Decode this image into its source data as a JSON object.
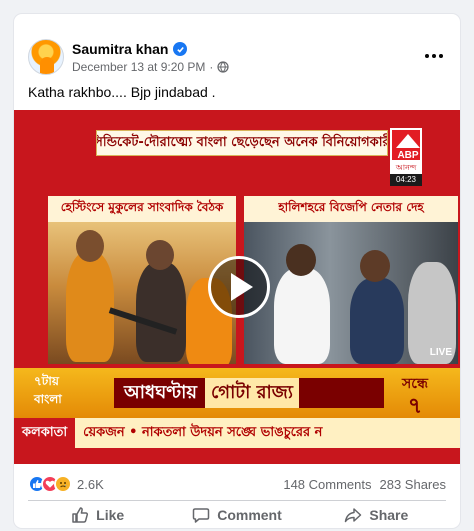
{
  "post": {
    "author": "Saumitra khan",
    "timestamp": "December 13 at 9:20 PM",
    "separator": "·",
    "text": "Katha rakhbo.... Bjp jindabad ."
  },
  "video": {
    "top_ticker": "'সিন্ডিকেট-দৌরাত্ম্যে বাংলা ছেড়েছেন অনেক বিনিয়োগকারী'",
    "logo_text": "ABP",
    "logo_sub": "আনন্দ",
    "clock": "04:23",
    "left_panel_title": "হেস্টিংসে মুকুলের সাংবাদিক বৈঠক",
    "right_panel_title": "হালিশহরে বিজেপি নেতার দেহ",
    "live_tag": "LIVE",
    "banner_logo_line1": "৭টায়",
    "banner_logo_line2": "বাংলা",
    "banner_text": "আধঘণ্টায়",
    "banner_highlight": "গোটা রাজ্য",
    "banner_right_small": "সন্ধে",
    "banner_right_big": "৭",
    "ticker_city": "কলকাতা",
    "ticker_text": "য়েকজন  •  নাকতলা উদয়ন সঙ্ঘে ভাঙচুরের ন"
  },
  "stats": {
    "reaction_count": "2.6K",
    "comments": "148 Comments",
    "shares": "283 Shares"
  },
  "actions": {
    "like": "Like",
    "comment": "Comment",
    "share": "Share"
  },
  "colors": {
    "facebook_blue": "#1877f2",
    "abp_red": "#c8161d",
    "secondary_text": "#65676b"
  }
}
